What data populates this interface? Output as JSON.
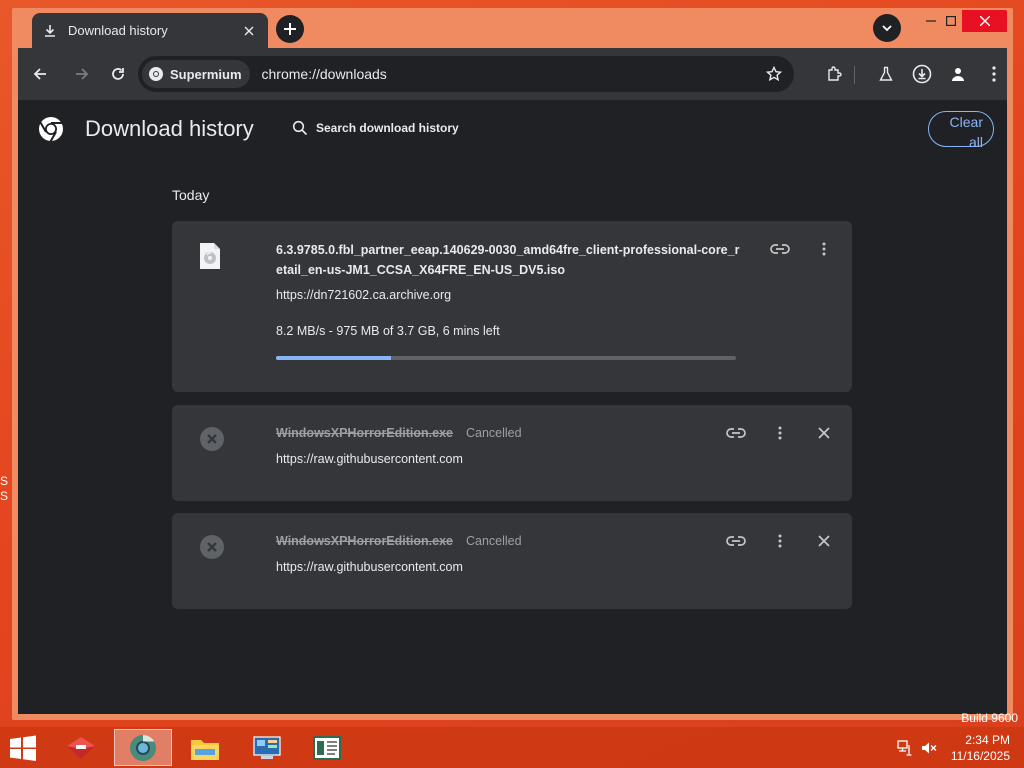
{
  "tab": {
    "title": "Download history",
    "icon": "download-icon"
  },
  "toolbar": {
    "site_chip": "Supermium",
    "url": "chrome://downloads"
  },
  "page": {
    "title": "Download history",
    "search_placeholder": "Search download history",
    "clear_all": "Clear all",
    "section_date": "Today"
  },
  "downloads": [
    {
      "name": "6.3.9785.0.fbl_partner_eeap.140629-0030_amd64fre_client-professional-core_retail_en-us-JM1_CCSA_X64FRE_EN-US_DV5.iso",
      "url": "https://dn721602.ca.archive.org",
      "progress_text": "8.2 MB/s - 975 MB of 3.7 GB, 6 mins left",
      "progress": 0.25,
      "state": "in-progress"
    },
    {
      "name": "WindowsXPHorrorEdition.exe",
      "status": "Cancelled",
      "url": "https://raw.githubusercontent.com",
      "state": "cancelled"
    },
    {
      "name": "WindowsXPHorrorEdition.exe",
      "status": "Cancelled",
      "url": "https://raw.githubusercontent.com",
      "state": "cancelled"
    }
  ],
  "desktop": {
    "build_text": "Build 9600"
  },
  "taskbar": {
    "time": "2:34 PM",
    "date": "11/16/2025",
    "apps": [
      "red-app-icon",
      "chrome-icon",
      "file-explorer-icon",
      "control-panel-icon",
      "document-app-icon"
    ]
  },
  "colors": {
    "accent": "#8ab4f8",
    "page_bg": "#202124",
    "card_bg": "#35363a",
    "desktop": "#e4461f"
  }
}
